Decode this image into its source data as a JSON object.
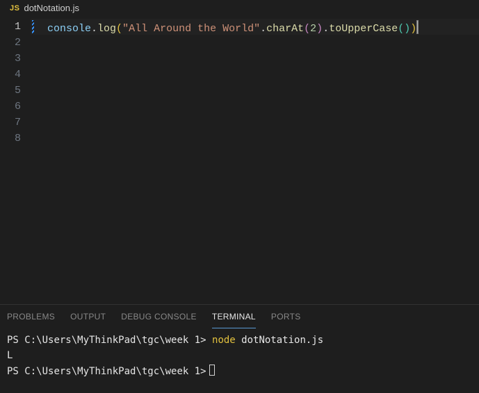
{
  "tab": {
    "badge": "JS",
    "filename": "dotNotation.js"
  },
  "code": {
    "obj": "console",
    "dot1": ".",
    "log": "log",
    "openA": "(",
    "str": "\"All Around the World\"",
    "dot2": ".",
    "charAt": "charAt",
    "openB": "(",
    "num": "2",
    "closeB": ")",
    "dot3": ".",
    "upper": "toUpperCase",
    "openC": "(",
    "closeC": ")",
    "closeA": ")"
  },
  "gutter": {
    "l1": "1",
    "l2": "2",
    "l3": "3",
    "l4": "4",
    "l5": "5",
    "l6": "6",
    "l7": "7",
    "l8": "8"
  },
  "panel": {
    "tabs": {
      "problems": "PROBLEMS",
      "output": "OUTPUT",
      "debug": "DEBUG CONSOLE",
      "terminal": "TERMINAL",
      "ports": "PORTS"
    }
  },
  "terminal": {
    "prompt1_ps": "PS ",
    "prompt1_path": "C:\\Users\\MyThinkPad\\tgc\\week 1> ",
    "prompt1_cmd": "node",
    "prompt1_arg": " dotNotation.js",
    "output": "L",
    "prompt2_ps": "PS ",
    "prompt2_path": "C:\\Users\\MyThinkPad\\tgc\\week 1>"
  }
}
